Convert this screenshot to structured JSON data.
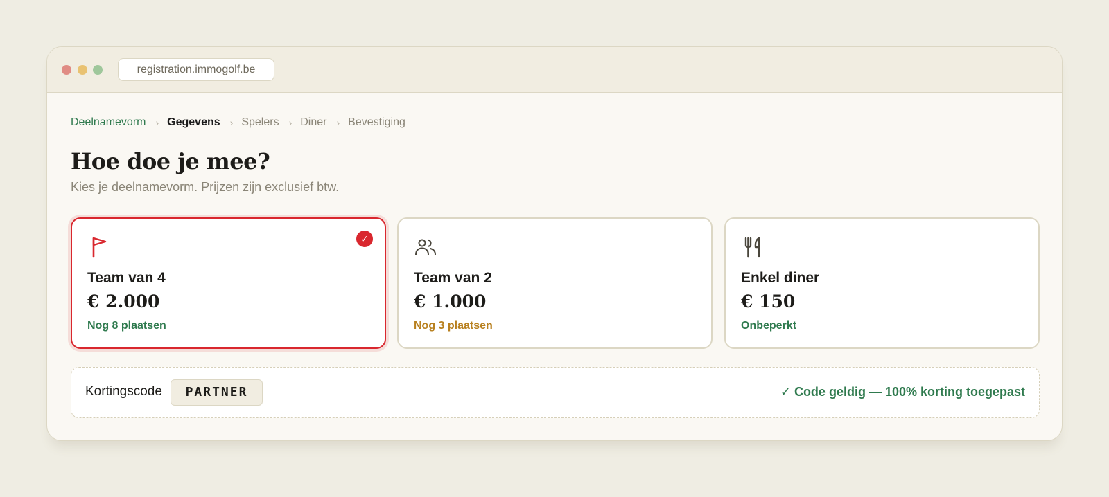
{
  "browser": {
    "url": "registration.immogolf.be"
  },
  "breadcrumb": {
    "separator": "›",
    "steps": [
      {
        "label": "Deelnamevorm",
        "state": "done"
      },
      {
        "label": "Gegevens",
        "state": "current"
      },
      {
        "label": "Spelers",
        "state": "upcoming"
      },
      {
        "label": "Diner",
        "state": "upcoming"
      },
      {
        "label": "Bevestiging",
        "state": "upcoming"
      }
    ]
  },
  "page": {
    "title": "Hoe doe je mee?",
    "subtitle": "Kies je deelnamevorm. Prijzen zijn exclusief btw."
  },
  "options": [
    {
      "icon": "flag-icon",
      "name": "Team van 4",
      "price": "€ 2.000",
      "availability": "Nog 8 plaatsen",
      "availability_color": "#2f7a4e",
      "selected": true,
      "check_glyph": "✓"
    },
    {
      "icon": "users-icon",
      "name": "Team van 2",
      "price": "€ 1.000",
      "availability": "Nog 3 plaatsen",
      "availability_color": "#b8801f",
      "selected": false
    },
    {
      "icon": "cutlery-icon",
      "name": "Enkel diner",
      "price": "€ 150",
      "availability": "Onbeperkt",
      "availability_color": "#2f7a4e",
      "selected": false
    }
  ],
  "discount": {
    "label": "Kortingscode",
    "code": "PARTNER",
    "status": "✓ Code geldig — 100% korting toegepast"
  },
  "colors": {
    "accent": "#d9272e",
    "success": "#2f7a4e",
    "warning": "#b8801f",
    "background": "#efede3"
  }
}
